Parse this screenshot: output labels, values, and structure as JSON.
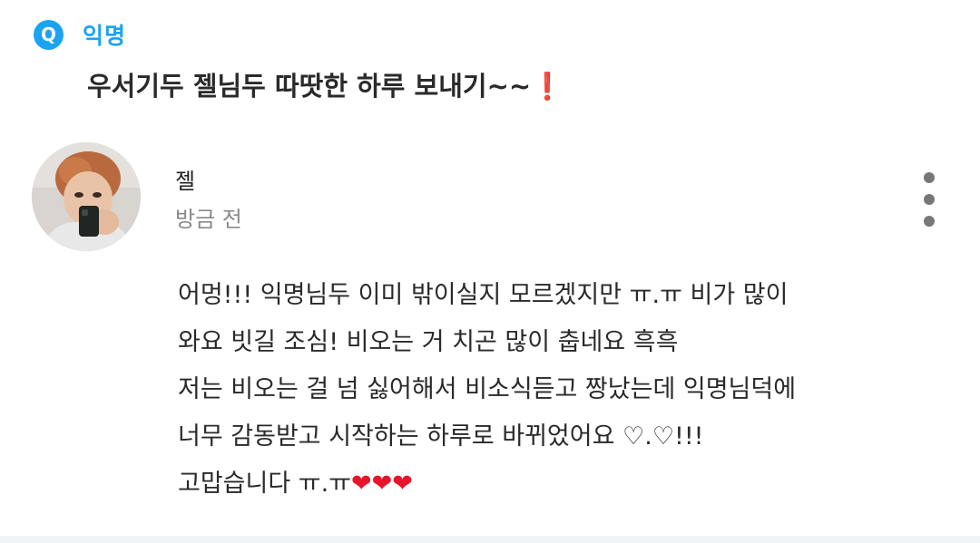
{
  "question": {
    "badge": "Q",
    "author": "익명",
    "text": "우서기두 젤님두 따땃한 하루 보내기~~",
    "emoji": "❗"
  },
  "answer": {
    "name": "젤",
    "time": "방금 전",
    "lines": [
      "어멍!!! 익명님두 이미 밖이실지 모르겠지만 ㅠ.ㅠ 비가 많이",
      "와요 빗길 조심! 비오는 거 치곤 많이 춥네요 흑흑",
      "저는 비오는 걸 넘 싫어해서 비소식듣고 짱났는데 익명님덕에",
      "너무 감동받고 시작하는 하루로 바뀌었어요 ♡.♡!!!",
      "고맙습니다 ㅠ.ㅠ"
    ],
    "hearts": "❤❤❤"
  },
  "colors": {
    "accent": "#1aa3f0",
    "heart": "#e8152a",
    "muted": "#8a8a8a"
  },
  "icons": {
    "badge": "q-badge-icon",
    "more": "more-vertical-icon",
    "avatar": "profile-photo"
  }
}
